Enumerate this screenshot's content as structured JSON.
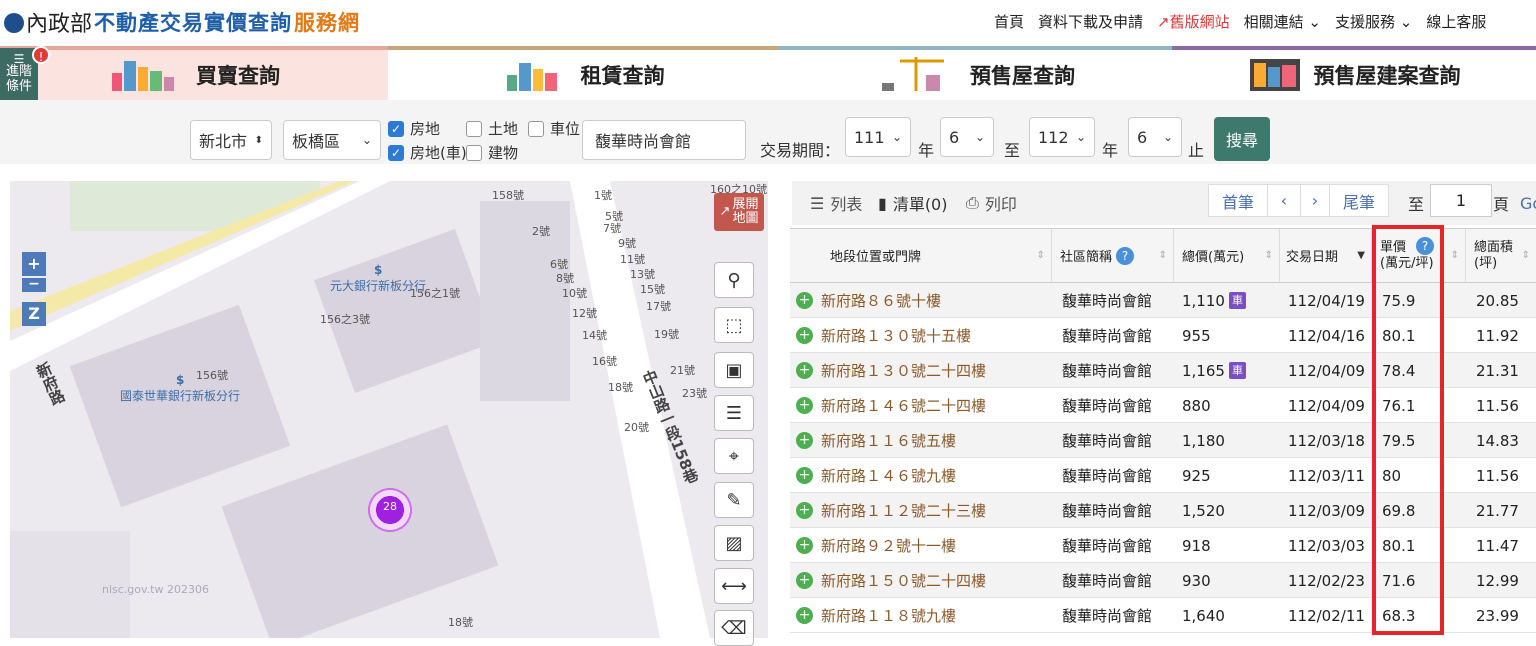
{
  "header": {
    "logo_moi": "內政部",
    "logo_site": "不動產交易實價查詢",
    "logo_site2": "服務網",
    "nav": [
      "首頁",
      "資料下載及申請",
      "舊版網站",
      "相關連結",
      "支援服務",
      "線上客服"
    ]
  },
  "tabs": [
    {
      "label": "買賣查詢",
      "color": "#e8a79c",
      "bg": "#fbe3df"
    },
    {
      "label": "租賃查詢",
      "color": "#c9a47a",
      "bg": "#ffffff"
    },
    {
      "label": "預售屋查詢",
      "color": "#8db6c4",
      "bg": "#ffffff"
    },
    {
      "label": "預售屋建案查詢",
      "color": "#8a6aa8",
      "bg": "#ffffff"
    }
  ],
  "advanced": {
    "label": "進階條件",
    "badge": "!"
  },
  "search": {
    "city": "新北市",
    "district": "板橋區",
    "checks": [
      {
        "label": "房地",
        "checked": true
      },
      {
        "label": "土地",
        "checked": false
      },
      {
        "label": "車位",
        "checked": false
      },
      {
        "label": "房地(車)",
        "checked": true
      },
      {
        "label": "建物",
        "checked": false
      }
    ],
    "keyword": "馥華時尚會館",
    "period_label": "交易期間：",
    "from_year": "111",
    "from_month": "6",
    "to_year": "112",
    "to_month": "6",
    "year_unit": "年",
    "to_word": "至",
    "end_word": "止",
    "search_button": "搜尋"
  },
  "map": {
    "expand_label": "展開地圖",
    "cluster_count": "28",
    "street_1": "新府路",
    "street_2": "中山路一段158巷",
    "labels": [
      "158號",
      "1號",
      "2號",
      "5號",
      "7號",
      "9號",
      "6號",
      "11號",
      "8號",
      "13號",
      "10號",
      "15號",
      "17號",
      "12號",
      "14號",
      "19號",
      "16號",
      "21號",
      "18號",
      "23號",
      "20號",
      "156之1號",
      "156之3號",
      "156號",
      "元大銀行新板分行",
      "國泰世華銀行新板分行",
      "160之10號",
      "18號",
      "nlsc.gov.tw 202306"
    ],
    "attribution": "nlsc.gov.tw 202306"
  },
  "list": {
    "view_list": "列表",
    "bookmark": "清單(0)",
    "print": "列印",
    "first": "首筆",
    "last": "尾筆",
    "to": "至",
    "page": "1",
    "page_unit": "頁",
    "go": "Go"
  },
  "table": {
    "headers": [
      "地段位置或門牌",
      "社區簡稱",
      "總價(萬元)",
      "交易日期",
      "單價\n(萬元/坪)",
      "總面積\n(坪)"
    ],
    "rows": [
      {
        "addr": "新府路８６號十樓",
        "comm": "馥華時尚會館",
        "total": "1,110",
        "car": true,
        "date": "112/04/19",
        "unit": "75.9",
        "area": "20.85"
      },
      {
        "addr": "新府路１３０號十五樓",
        "comm": "馥華時尚會館",
        "total": "955",
        "car": false,
        "date": "112/04/16",
        "unit": "80.1",
        "area": "11.92"
      },
      {
        "addr": "新府路１３０號二十四樓",
        "comm": "馥華時尚會館",
        "total": "1,165",
        "car": true,
        "date": "112/04/09",
        "unit": "78.4",
        "area": "21.31"
      },
      {
        "addr": "新府路１４６號二十四樓",
        "comm": "馥華時尚會館",
        "total": "880",
        "car": false,
        "date": "112/04/09",
        "unit": "76.1",
        "area": "11.56"
      },
      {
        "addr": "新府路１１６號五樓",
        "comm": "馥華時尚會館",
        "total": "1,180",
        "car": false,
        "date": "112/03/18",
        "unit": "79.5",
        "area": "14.83"
      },
      {
        "addr": "新府路１４６號九樓",
        "comm": "馥華時尚會館",
        "total": "925",
        "car": false,
        "date": "112/03/11",
        "unit": "80",
        "area": "11.56"
      },
      {
        "addr": "新府路１１２號二十三樓",
        "comm": "馥華時尚會館",
        "total": "1,520",
        "car": false,
        "date": "112/03/09",
        "unit": "69.8",
        "area": "21.77"
      },
      {
        "addr": "新府路９２號十一樓",
        "comm": "馥華時尚會館",
        "total": "918",
        "car": false,
        "date": "112/03/03",
        "unit": "80.1",
        "area": "11.47"
      },
      {
        "addr": "新府路１５０號二十四樓",
        "comm": "馥華時尚會館",
        "total": "930",
        "car": false,
        "date": "112/02/23",
        "unit": "71.6",
        "area": "12.99"
      },
      {
        "addr": "新府路１１８號九樓",
        "comm": "馥華時尚會館",
        "total": "1,640",
        "car": false,
        "date": "112/02/11",
        "unit": "68.3",
        "area": "23.99"
      }
    ],
    "car_badge": "車"
  }
}
